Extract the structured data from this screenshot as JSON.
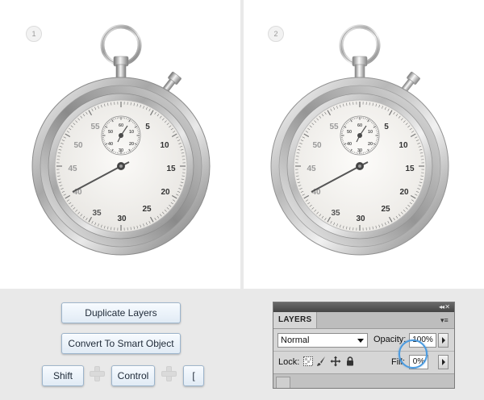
{
  "steps": [
    {
      "number": "1"
    },
    {
      "number": "2"
    }
  ],
  "stopwatch": {
    "outer_minutes": [
      "55",
      "5",
      "50",
      "10",
      "45",
      "15",
      "40",
      "20",
      "35",
      "25",
      "30"
    ],
    "inner_dial": [
      "60",
      "10",
      "50",
      "20",
      "40",
      "30"
    ]
  },
  "buttons": {
    "duplicate_label": "Duplicate Layers",
    "convert_label": "Convert To Smart Object"
  },
  "shortcut": {
    "shift": "Shift",
    "control": "Control",
    "bracket": "["
  },
  "layers_panel": {
    "tab_label": "LAYERS",
    "blend_mode": "Normal",
    "opacity_label": "Opacity:",
    "opacity_value": "100%",
    "lock_label": "Lock:",
    "fill_label": "Fill:",
    "fill_value": "0%",
    "collapse_icon": "double-chevron-icon",
    "menu_icon": "panel-menu-icon"
  },
  "colors": {
    "highlight_ring": "#4a9be0",
    "button_border": "#9cb4cb"
  }
}
